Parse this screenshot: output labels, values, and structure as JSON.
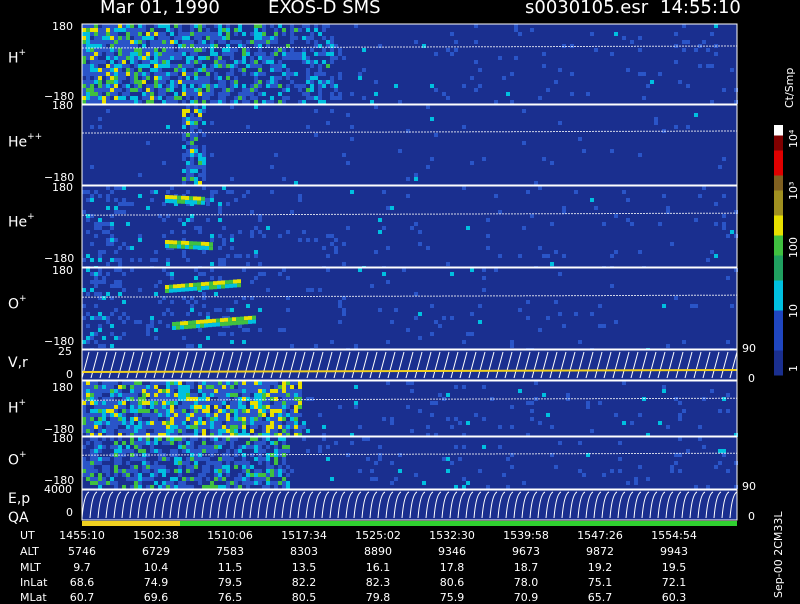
{
  "header": {
    "date": "Mar 01, 1990",
    "instrument": "EXOS-D SMS",
    "file": "s0030105.esr",
    "time": "14:55:10"
  },
  "colors": {
    "background": "#000000",
    "panel": "#1a2f8f",
    "noise": "#2a55c8",
    "cyan": "#00c0e0",
    "green": "#40c040",
    "yellow": "#e8e000",
    "red": "#e00000",
    "white": "#ffffff",
    "qa_yellow": "#f0d020",
    "qa_green": "#30d030"
  },
  "chart_data": {
    "type": "heatmap",
    "panels": [
      {
        "label": "H",
        "charge": "+",
        "ymax": "180",
        "ymin": "−180"
      },
      {
        "label": "He",
        "charge": "++",
        "ymax": "180",
        "ymin": "−180"
      },
      {
        "label": "He",
        "charge": "+",
        "ymax": "180",
        "ymin": "−180"
      },
      {
        "label": "O",
        "charge": "+",
        "ymax": "180",
        "ymin": "−180"
      },
      {
        "label": "V,r",
        "charge": "",
        "ymax": "25",
        "ymin": "0",
        "right_max": "90",
        "right_min": "0"
      },
      {
        "label": "H",
        "charge": "+",
        "ymax": "180",
        "ymin": "−180"
      },
      {
        "label": "O",
        "charge": "+",
        "ymax": "180",
        "ymin": "−180"
      },
      {
        "label": "E,p",
        "label2": "QA",
        "charge": "",
        "ymax": "4000",
        "ymin": "0",
        "right_max": "90",
        "right_min": "0"
      }
    ],
    "colorbar": {
      "unit": "Ct/Smp",
      "ticks": [
        "1",
        "10",
        "100",
        "10³",
        "10⁴"
      ]
    },
    "table": {
      "row_labels": [
        "UT",
        "ALT",
        "MLT",
        "InLat",
        "MLat"
      ],
      "columns": [
        [
          "1455:10",
          "5746",
          "9.7",
          "68.6",
          "60.7"
        ],
        [
          "1502:38",
          "6729",
          "10.4",
          "74.9",
          "69.6"
        ],
        [
          "1510:06",
          "7583",
          "11.5",
          "79.5",
          "76.5"
        ],
        [
          "1517:34",
          "8303",
          "13.5",
          "82.2",
          "80.5"
        ],
        [
          "1525:02",
          "8890",
          "16.1",
          "82.3",
          "79.8"
        ],
        [
          "1532:30",
          "9346",
          "17.8",
          "80.6",
          "75.9"
        ],
        [
          "1539:58",
          "9673",
          "18.7",
          "78.0",
          "70.9"
        ],
        [
          "1547:26",
          "9872",
          "19.2",
          "75.1",
          "65.7"
        ],
        [
          "1554:54",
          "9943",
          "19.5",
          "72.1",
          "60.3"
        ]
      ]
    },
    "side_label": "Sep-00 2CM33L"
  }
}
